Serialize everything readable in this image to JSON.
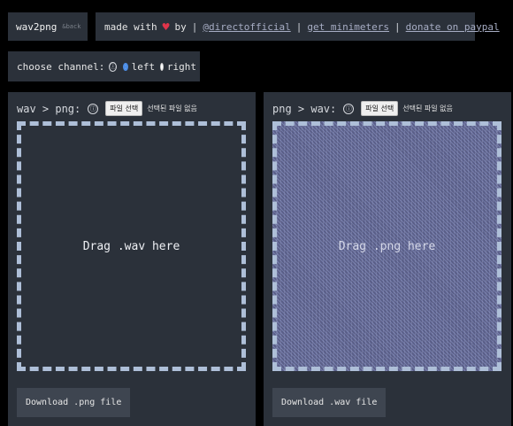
{
  "header": {
    "logo": "wav2png",
    "back": "&back",
    "made_with": "made with",
    "heart": "♥",
    "by": "by",
    "links": [
      "@directofficial",
      "get minimeters",
      "donate on paypal"
    ],
    "separator": "|"
  },
  "channel": {
    "label": "choose channel:",
    "info_icon": "ⓘ",
    "options": [
      "left",
      "right"
    ],
    "selected": "left"
  },
  "wav_to_png": {
    "title": "wav > png:",
    "info_icon": "ⓘ",
    "file_button": "파일 선택",
    "no_file": "선택된 파일 없음",
    "drop_text": "Drag .wav here",
    "download": "Download .png file"
  },
  "png_to_wav": {
    "title": "png > wav:",
    "info_icon": "ⓘ",
    "file_button": "파일 선택",
    "no_file": "선택된 파일 없음",
    "drop_text": "Drag .png here",
    "download": "Download .wav file"
  },
  "colors": {
    "panel": "#2b313a",
    "accent_radio": "#4c8de6",
    "heart": "#e0344a",
    "dash": "#aebfd8"
  }
}
